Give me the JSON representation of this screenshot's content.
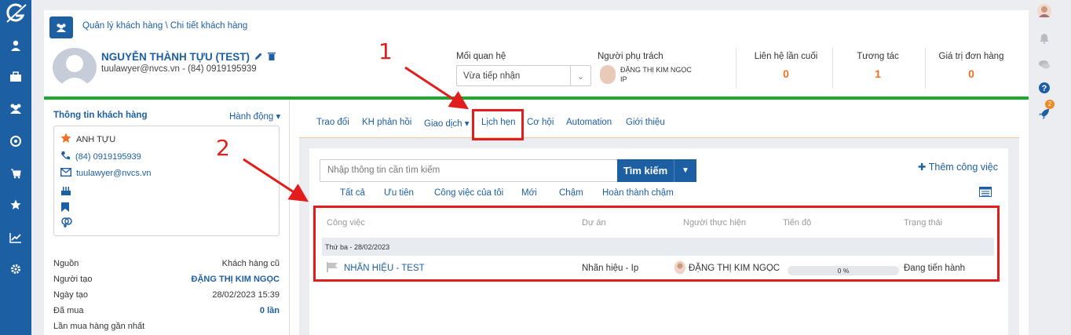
{
  "breadcrumb": "Quản lý khách hàng \\ Chi tiết khách hàng",
  "customer": {
    "name": "NGUYỄN THÀNH TỰU (TEST)",
    "contact": "tuulawyer@nvcs.vn - (84) 0919195939"
  },
  "annotations": {
    "one": "1",
    "two": "2"
  },
  "relation": {
    "label": "Mối quan hệ",
    "value": "Vừa tiếp nhận"
  },
  "owner": {
    "label": "Người phụ trách",
    "name": "ĐẶNG THỊ KIM NGỌC",
    "role": "IP"
  },
  "stats": [
    {
      "label": "Liên hệ lần cuối",
      "value": "0"
    },
    {
      "label": "Tương tác",
      "value": "1"
    },
    {
      "label": "Giá trị đơn hàng",
      "value": "0"
    }
  ],
  "sidebar": {
    "title": "Thông tin khách hàng",
    "action": "Hành động",
    "alias": "ANH TỰU",
    "phone": "(84) 0919195939",
    "email": "tuulawyer@nvcs.vn",
    "fields": [
      {
        "label": "Nguồn",
        "value": "Khách hàng cũ"
      },
      {
        "label": "Người tạo",
        "value": "ĐẶNG THỊ KIM NGỌC"
      },
      {
        "label": "Ngày tạo",
        "value": "28/02/2023 15:39"
      },
      {
        "label": "Đã mua",
        "value": "0 lần"
      },
      {
        "label": "Lần mua hàng gần nhất",
        "value": ""
      }
    ]
  },
  "tabs": [
    "Trao đổi",
    "KH phản hồi",
    "Giao dịch",
    "Lịch hẹn",
    "Cơ hội",
    "Automation",
    "Giới thiệu"
  ],
  "search": {
    "placeholder": "Nhập thông tin cần tìm kiếm",
    "button": "Tìm kiếm"
  },
  "add_task": "Thêm công việc",
  "filters": [
    "Tất cả",
    "Ưu tiên",
    "Công việc của tôi",
    "Mới",
    "Chậm",
    "Hoàn thành chậm"
  ],
  "table": {
    "headers": [
      "Công việc",
      "Dự án",
      "Người thực hiện",
      "Tiến độ",
      "Trạng thái"
    ],
    "group": "Thứ ba - 28/02/2023",
    "row": {
      "task": "NHÃN HIỆU - TEST",
      "project": "Nhãn hiệu - Ip",
      "assignee": "ĐẶNG THỊ KIM NGỌC",
      "progress": "0 %",
      "status": "Đang tiến hành"
    }
  },
  "notification_badge": "2",
  "colors": {
    "primary": "#1d5fa3",
    "accent": "#f26f21",
    "green": "#1ea830",
    "annotation": "#e21d1d"
  }
}
